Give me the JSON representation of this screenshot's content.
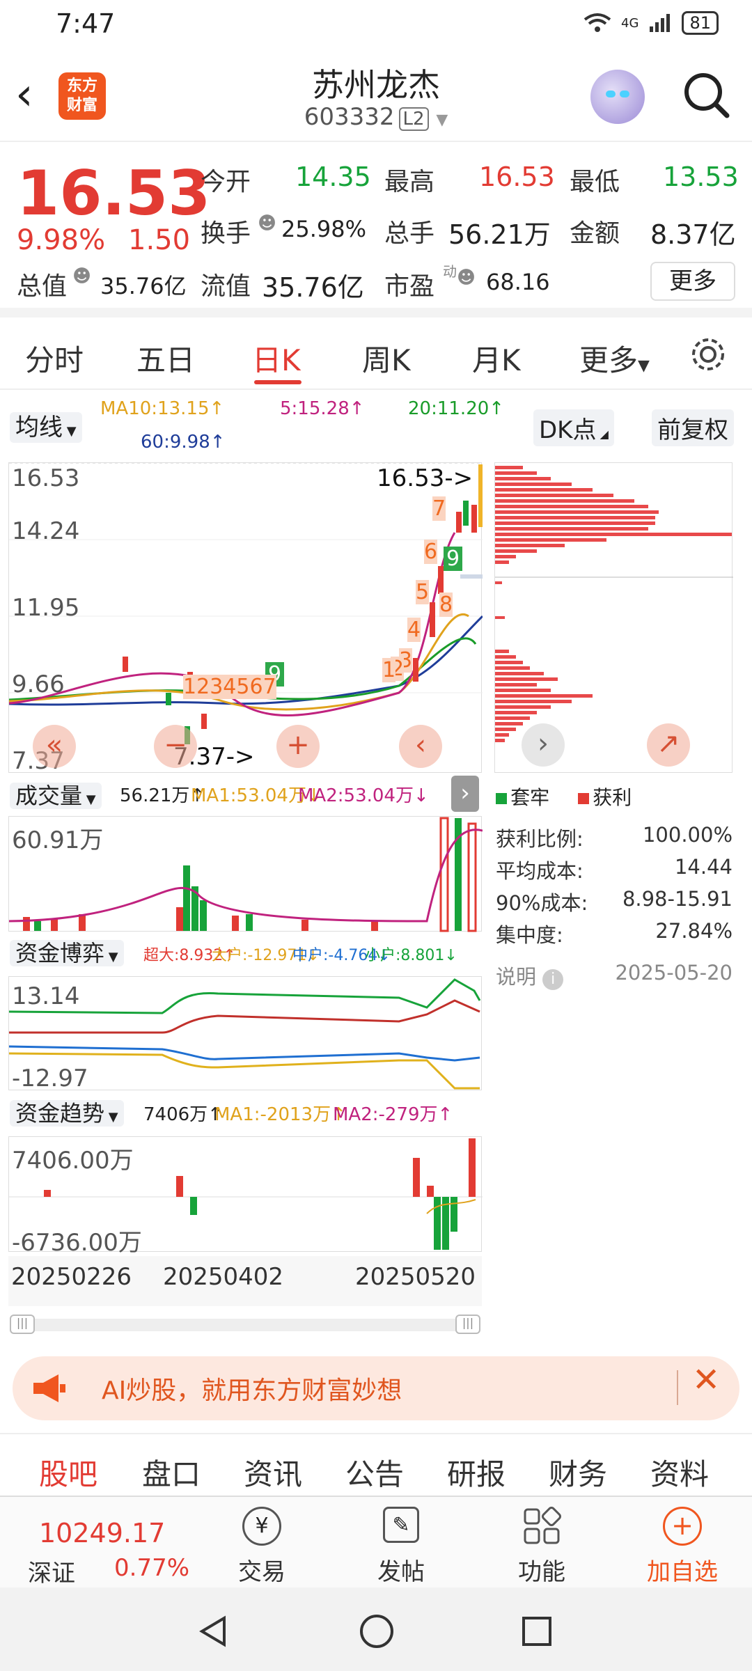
{
  "status": {
    "time": "7:47",
    "battery": "81",
    "signal": "4G"
  },
  "header": {
    "title": "苏州龙杰",
    "code": "603332",
    "level": "L2",
    "logo_line1": "东方",
    "logo_line2": "财富"
  },
  "quote": {
    "price": "16.53",
    "pct": "9.98%",
    "change": "1.50",
    "open_label": "今开",
    "open": "14.35",
    "high_label": "最高",
    "high": "16.53",
    "low_label": "最低",
    "low": "13.53",
    "turnover_label": "换手",
    "turnover": "25.98%",
    "volume_label": "总手",
    "volume": "56.21万",
    "amount_label": "金额",
    "amount": "8.37亿",
    "mktcap_label": "总值",
    "mktcap": "35.76亿",
    "float_label": "流值",
    "float_cap": "35.76亿",
    "pe_label": "市盈",
    "pe_sup": "动",
    "pe": "68.16",
    "more": "更多"
  },
  "tabs": {
    "items": [
      "分时",
      "五日",
      "日K",
      "周K",
      "月K",
      "更多"
    ],
    "active": "日K"
  },
  "indicators": {
    "ma_select": "均线",
    "ma10": "MA10:13.15↑",
    "ma5": "5:15.28↑",
    "ma20": "20:11.20↑",
    "ma60": "60:9.98↑",
    "dk": "DK点",
    "adjust": "前复权"
  },
  "kline": {
    "y_labels": [
      "16.53",
      "14.24",
      "11.95",
      "9.66",
      "7.37"
    ],
    "high_marker": "16.53->",
    "low_marker": "7.37->",
    "marker_numbers": [
      "1",
      "2",
      "3",
      "4",
      "5",
      "6",
      "7",
      "8",
      "9",
      "1",
      "2",
      "3",
      "4",
      "5",
      "6",
      "7",
      "9"
    ]
  },
  "volume": {
    "select": "成交量",
    "value": "56.21万↑",
    "ma1": "MA1:53.04万↓",
    "ma2": "MA2:53.04万↓",
    "y_max": "60.91万"
  },
  "game": {
    "select": "资金博弈",
    "super": "超大:8.932↑",
    "large": "大户:-12.971↓",
    "mid": "中户:-4.764↓",
    "small": "小户:8.801↓",
    "y_max": "13.14",
    "y_min": "-12.97"
  },
  "trend": {
    "select": "资金趋势",
    "value": "7406万↑",
    "ma1": "MA1:-2013万↑",
    "ma2": "MA2:-279万↑",
    "y_max": "7406.00万",
    "y_min": "-6736.00万"
  },
  "dates": [
    "20250226",
    "20250402",
    "20250520"
  ],
  "chips": {
    "legend_trapped": "套牢",
    "legend_profit": "获利",
    "profit_ratio_label": "获利比例:",
    "profit_ratio": "100.00%",
    "avg_cost_label": "平均成本:",
    "avg_cost": "14.44",
    "cost90_label": "90%成本:",
    "cost90": "8.98-15.91",
    "concentration_label": "集中度:",
    "concentration": "27.84%",
    "note_label": "说明",
    "date": "2025-05-20"
  },
  "banner": {
    "text": "AI炒股，就用东方财富妙想"
  },
  "subtabs": {
    "items": [
      "股吧",
      "盘口",
      "资讯",
      "公告",
      "研报",
      "财务",
      "资料"
    ],
    "active": "股吧"
  },
  "bottombar": {
    "index_value": "10249.17",
    "index_name": "深证",
    "index_pct": "0.77%",
    "trade": "交易",
    "post": "发帖",
    "function": "功能",
    "add": "加自选"
  },
  "colors": {
    "up": "#e23b33",
    "down": "#17a33a",
    "accent": "#f0561f"
  }
}
